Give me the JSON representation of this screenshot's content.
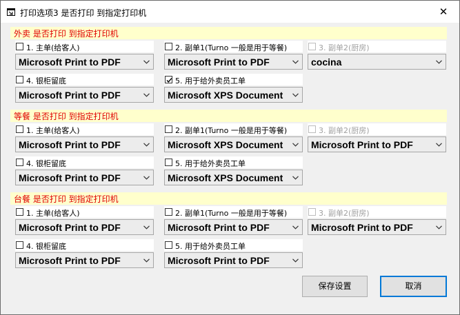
{
  "window": {
    "title": "打印选项3 是否打印 到指定打印机",
    "close_glyph": "✕"
  },
  "sections": [
    {
      "title": "外卖 是否打印 到指定打印机",
      "slots": [
        {
          "label": "1. 主单(给客人)",
          "checked": false,
          "disabled": false,
          "printer": "Microsoft Print to PDF"
        },
        {
          "label": "2. 副单1(Turno 一般是用于等餐)",
          "checked": false,
          "disabled": false,
          "printer": "Microsoft Print to PDF"
        },
        {
          "label": "3. 副单2(厨房)",
          "checked": false,
          "disabled": true,
          "printer": "cocina"
        },
        {
          "label": "4. 银柜留底",
          "checked": false,
          "disabled": false,
          "printer": "Microsoft Print to PDF"
        },
        {
          "label": "5. 用于给外卖员工单",
          "checked": true,
          "disabled": false,
          "printer": "Microsoft XPS Document"
        }
      ]
    },
    {
      "title": "等餐 是否打印 到指定打印机",
      "slots": [
        {
          "label": "1. 主单(给客人)",
          "checked": false,
          "disabled": false,
          "printer": "Microsoft Print to PDF"
        },
        {
          "label": "2. 副单1(Turno 一般是用于等餐)",
          "checked": false,
          "disabled": false,
          "printer": "Microsoft XPS Document"
        },
        {
          "label": "3. 副单2(厨房)",
          "checked": false,
          "disabled": true,
          "printer": "Microsoft Print to PDF"
        },
        {
          "label": "4. 银柜留底",
          "checked": false,
          "disabled": false,
          "printer": "Microsoft Print to PDF"
        },
        {
          "label": "5. 用于给外卖员工单",
          "checked": false,
          "disabled": false,
          "printer": "Microsoft XPS Document"
        }
      ]
    },
    {
      "title": "台餐 是否打印 到指定打印机",
      "slots": [
        {
          "label": "1. 主单(给客人)",
          "checked": false,
          "disabled": false,
          "printer": "Microsoft Print to PDF"
        },
        {
          "label": "2. 副单1(Turno 一般是用于等餐)",
          "checked": false,
          "disabled": false,
          "printer": "Microsoft Print to PDF"
        },
        {
          "label": "3. 副单2(厨房)",
          "checked": false,
          "disabled": true,
          "printer": "Microsoft Print to PDF"
        },
        {
          "label": "4. 银柜留底",
          "checked": false,
          "disabled": false,
          "printer": "Microsoft Print to PDF"
        },
        {
          "label": "5. 用于给外卖员工单",
          "checked": false,
          "disabled": false,
          "printer": "Microsoft Print to PDF"
        }
      ]
    }
  ],
  "buttons": {
    "save": "保存设置",
    "cancel": "取消"
  },
  "colors": {
    "banner_bg": "#ffffcc",
    "banner_text": "#e00000",
    "focus_border": "#0078d7"
  }
}
